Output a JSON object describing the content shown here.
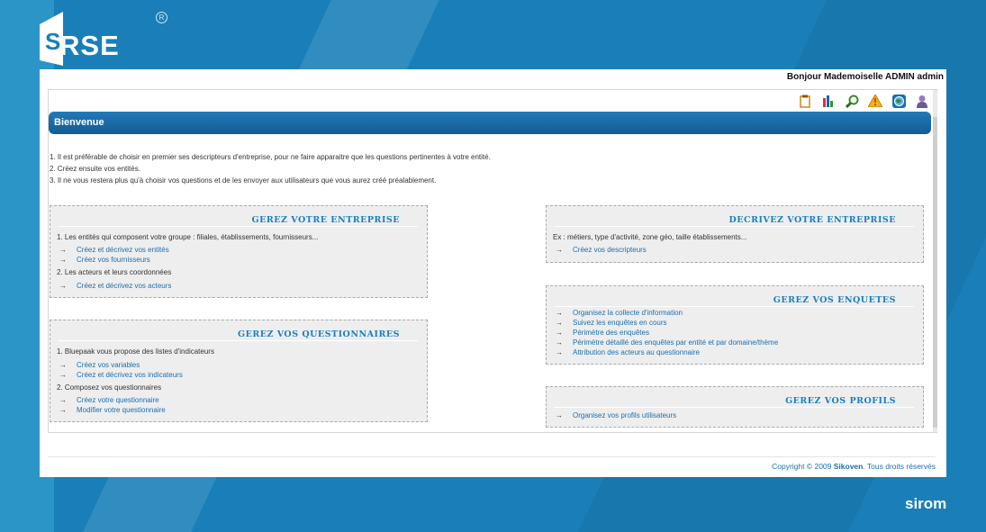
{
  "brand": {
    "logo_text": "RSE",
    "logo_mark": "S",
    "registered": "R",
    "company_logo": "sirom"
  },
  "header": {
    "greeting": "Bonjour Mademoiselle ADMIN admin"
  },
  "toolbar": {
    "icons": [
      "clipboard-icon",
      "chart-icon",
      "search-icon",
      "warning-icon",
      "globe-icon",
      "user-icon"
    ]
  },
  "welcome": {
    "title": "Bienvenue"
  },
  "intro": [
    "1. Il est préférable de choisir en premier ses descripteurs d'entreprise, pour ne faire apparaitre que les questions pertinentes à  votre entité.",
    "2. Créez ensuite vos entités.",
    "3. Il ne vous restera plus qu'à  choisir vos questions et de les envoyer aux utilisateurs que vous aurez créé préalablement."
  ],
  "arrow": "→",
  "boxes": {
    "entreprise": {
      "title": "GEREZ VOTRE ENTREPRISE",
      "text1": "1. Les entités qui composent votre groupe : filiales, établissements, fournisseurs...",
      "link1": "Créez et décrivez vos entités",
      "link2": "Créez vos fournisseurs",
      "text2": "2. Les acteurs et leurs coordonnées",
      "link3": "Créez et décrivez vos acteurs"
    },
    "questionnaires": {
      "title": "GEREZ VOS QUESTIONNAIRES",
      "text1": "1. Bluepaak vous propose des listes d'indicateurs",
      "link1": "Créez vos variables",
      "link2": "Créez et décrivez vos indicateurs",
      "text2": "2. Composez vos questionnaires",
      "link3": "Créez votre questionnaire",
      "link4": "Modifier votre questionnaire"
    },
    "decrivez": {
      "title": "DECRIVEZ VOTRE ENTREPRISE",
      "text1": "Ex : métiers, type d'activité, zone géo, taille établissements...",
      "link1": "Créez vos descripteurs"
    },
    "enquetes": {
      "title": "GEREZ VOS ENQUETES",
      "link1": "Organisez la collecte d'information",
      "link2": "Suivez les enquêtes en cours",
      "link3": "Périmètre des enquêtes",
      "link4": "Périmètre détaillé des enquêtes par entité et par domaine/thème",
      "link5": "Attribution des acteurs au questionnaire"
    },
    "profils": {
      "title": "GEREZ VOS PROFILS",
      "link1": "Organisez vos profils utilisateurs"
    }
  },
  "footer": {
    "prefix": "Copyright © 2009 ",
    "company": "Sikoven",
    "suffix": ". Tous droits réservés"
  }
}
